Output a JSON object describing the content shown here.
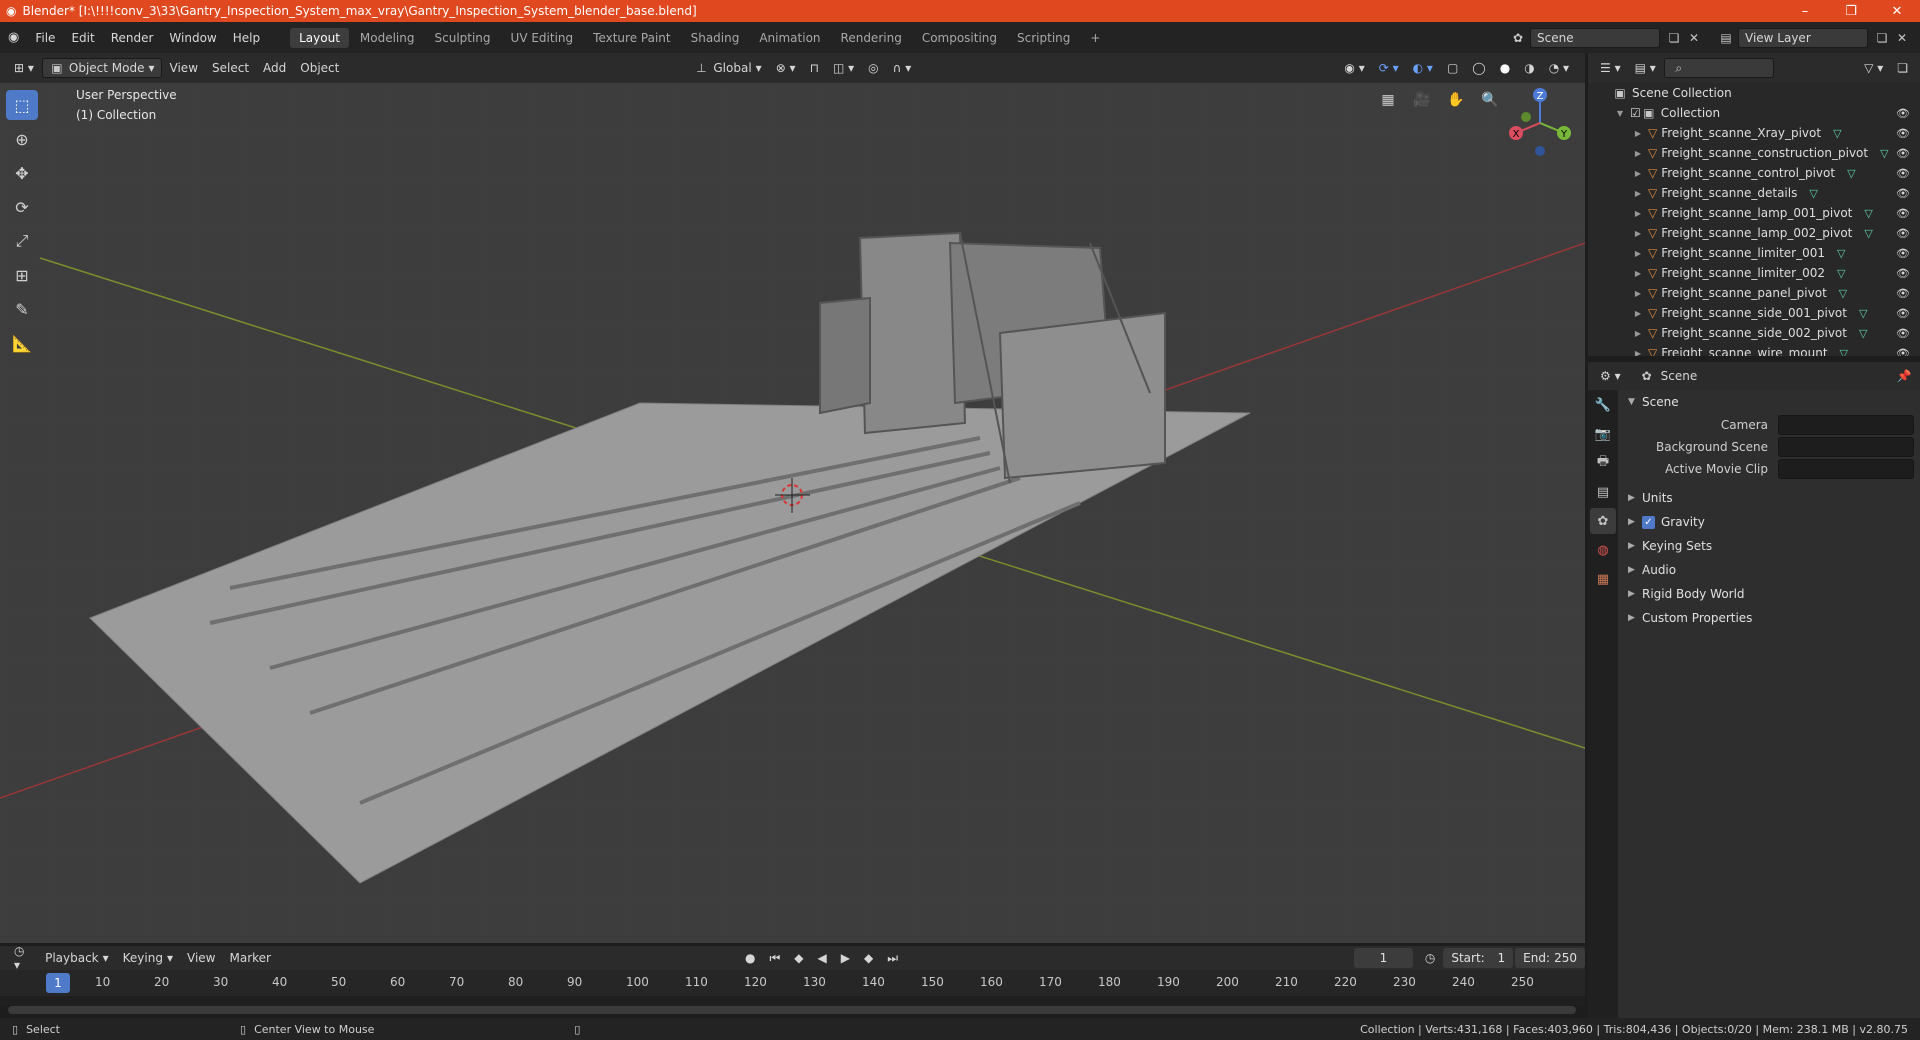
{
  "window": {
    "title": "Blender* [I:\\!!!!conv_3\\33\\Gantry_Inspection_System_max_vray\\Gantry_Inspection_System_blender_base.blend]"
  },
  "menu": [
    "File",
    "Edit",
    "Render",
    "Window",
    "Help"
  ],
  "workspaces": [
    "Layout",
    "Modeling",
    "Sculpting",
    "UV Editing",
    "Texture Paint",
    "Shading",
    "Animation",
    "Rendering",
    "Compositing",
    "Scripting"
  ],
  "scene_selector": "Scene",
  "view_layer": "View Layer",
  "viewport_header": {
    "mode": "Object Mode",
    "menus": [
      "View",
      "Select",
      "Add",
      "Object"
    ],
    "orientation": "Global"
  },
  "viewport": {
    "perspective": "User Perspective",
    "collection": "(1) Collection"
  },
  "gizmo": {
    "z": "Z",
    "y": "Y",
    "x": "X"
  },
  "outliner": {
    "root": "Scene Collection",
    "collection": "Collection",
    "items": [
      "Freight_scanne_Xray_pivot",
      "Freight_scanne_construction_pivot",
      "Freight_scanne_control_pivot",
      "Freight_scanne_details",
      "Freight_scanne_lamp_001_pivot",
      "Freight_scanne_lamp_002_pivot",
      "Freight_scanne_limiter_001",
      "Freight_scanne_limiter_002",
      "Freight_scanne_panel_pivot",
      "Freight_scanne_side_001_pivot",
      "Freight_scanne_side_002_pivot",
      "Freight_scanne_wire_mount"
    ]
  },
  "properties": {
    "header": "Scene",
    "panel": "Scene",
    "fields": [
      {
        "label": "Camera"
      },
      {
        "label": "Background Scene"
      },
      {
        "label": "Active Movie Clip"
      }
    ],
    "sections": [
      "Units",
      "Gravity",
      "Keying Sets",
      "Audio",
      "Rigid Body World",
      "Custom Properties"
    ],
    "gravity_checked": true
  },
  "timeline": {
    "menus": [
      "Playback",
      "Keying",
      "View",
      "Marker"
    ],
    "current_frame": "1",
    "start_label": "Start:",
    "start": "1",
    "end_label": "End:",
    "end": "250",
    "ticks": [
      "10",
      "20",
      "30",
      "40",
      "50",
      "60",
      "70",
      "80",
      "90",
      "100",
      "110",
      "120",
      "130",
      "140",
      "150",
      "160",
      "170",
      "180",
      "190",
      "200",
      "210",
      "220",
      "230",
      "240",
      "250"
    ]
  },
  "status": {
    "left": "Select",
    "middle": "Center View to Mouse",
    "right": "Collection | Verts:431,168 | Faces:403,960 | Tris:804,436 | Objects:0/20 | Mem: 238.1 MB | v2.80.75"
  },
  "colors": {
    "accent": "#4f7ac8",
    "titlebar": "#e0491f",
    "object_icon": "#e08a3c",
    "mesh_icon": "#5fd0b0"
  }
}
